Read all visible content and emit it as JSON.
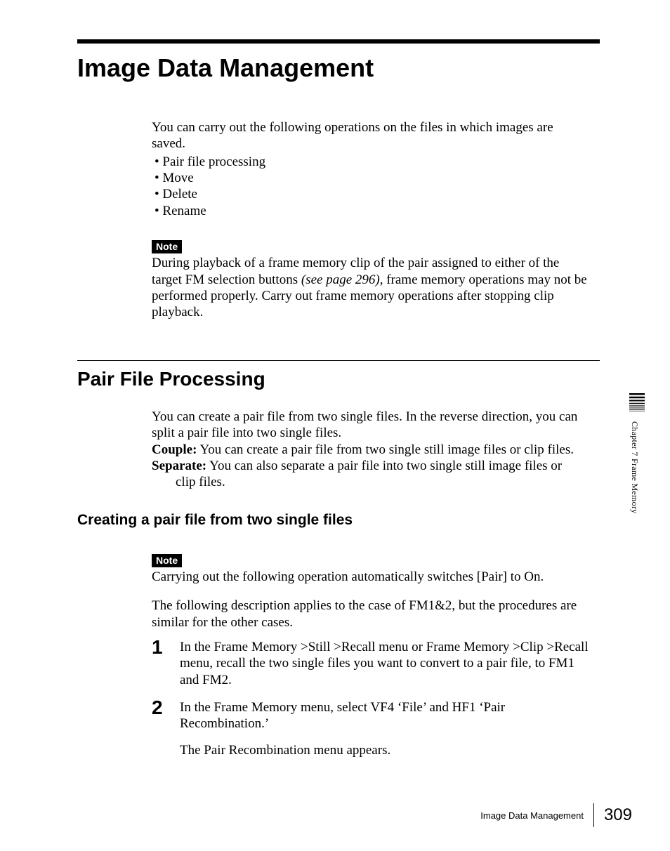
{
  "title": "Image Data Management",
  "intro": "You can carry out the following operations on the files in which images are saved.",
  "bullets": [
    "Pair file processing",
    "Move",
    "Delete",
    "Rename"
  ],
  "note_label": "Note",
  "note1_a": "During playback of a frame memory clip of the pair assigned to either of the target FM selection buttons ",
  "note1_ref": "(see page 296)",
  "note1_b": ", frame memory operations may not be performed properly. Carry out frame memory operations after stopping clip playback.",
  "section2_title": "Pair File Processing",
  "pair_intro": "You can create a pair file from two single files. In the reverse direction, you can split a pair file into two single files.",
  "defs": {
    "couple_term": "Couple:",
    "couple_body": " You can create a pair file from two single still image files or clip files.",
    "separate_term": "Separate:",
    "separate_body_a": " You can also separate a pair file into two single still image files or",
    "separate_body_b": "clip files."
  },
  "h3": "Creating a pair file from two single files",
  "note2": "Carrying out the following operation automatically switches [Pair] to On.",
  "case_intro": "The following description applies to the case of FM1&2, but the procedures are similar for the other cases.",
  "steps": {
    "s1_num": "1",
    "s1": "In the Frame Memory >Still >Recall menu or Frame Memory >Clip >Recall menu, recall the two single files you want to convert to a pair file, to FM1 and FM2.",
    "s2_num": "2",
    "s2": "In the Frame Memory menu, select VF4 ‘File’ and HF1 ‘Pair Recombination.’",
    "s2_result": "The Pair Recombination menu appears."
  },
  "sidetab": "Chapter 7  Frame Memory",
  "footer_label": "Image Data Management",
  "page_number": "309"
}
